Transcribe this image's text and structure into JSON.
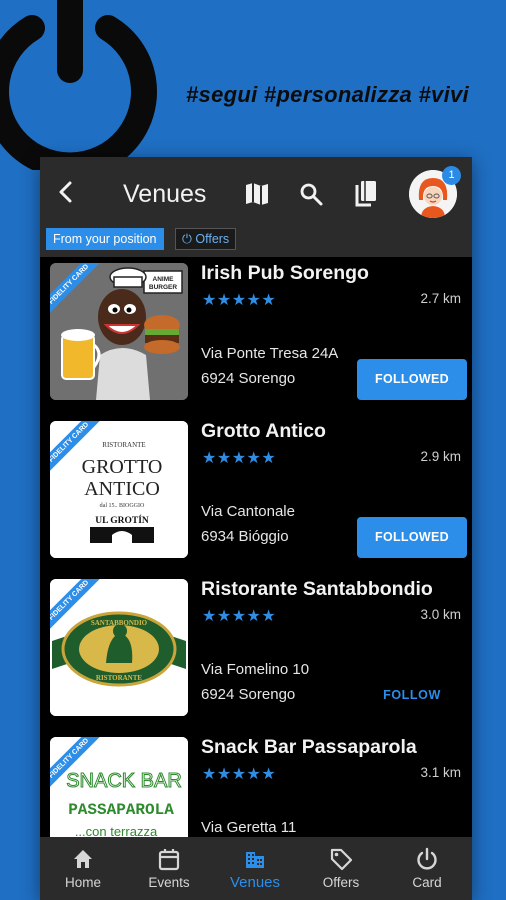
{
  "tagline": "#segui #personalizza #vivi",
  "header": {
    "title": "Venues",
    "notification_count": "1"
  },
  "filters": {
    "position": "From your position",
    "offers": "Offers"
  },
  "venues": [
    {
      "name": "Irish Pub Sorengo",
      "rating": "★★★★★",
      "distance": "2.7 km",
      "street": "Via Ponte Tresa 24A",
      "city": "6924 Sorengo",
      "action": "FOLLOWED",
      "ribbon": "FIDELITY CARD",
      "logo_text": "ANIME BURGER"
    },
    {
      "name": "Grotto Antico",
      "rating": "★★★★★",
      "distance": "2.9 km",
      "street": "Via Cantonale",
      "city": "6934 Bióggio",
      "action": "FOLLOWED",
      "ribbon": "FIDELITY CARD",
      "logo_top": "RISTORANTE",
      "logo_line1": "GROTTO",
      "logo_line2": "ANTICO",
      "logo_sub": "dal 15.. BIOGGIO",
      "logo_bottom": "UL GROTÍN"
    },
    {
      "name": "Ristorante Santabbondio",
      "rating": "★★★★★",
      "distance": "3.0 km",
      "street": "Via Fomelino 10",
      "city": "6924 Sorengo",
      "action": "FOLLOW",
      "ribbon": "FIDELITY CARD",
      "logo_top": "SANTABBONDIO",
      "logo_bottom": "RISTORANTE"
    },
    {
      "name": "Snack Bar Passaparola",
      "rating": "★★★★★",
      "distance": "3.1 km",
      "street": "Via Geretta 11",
      "city": "",
      "action": "",
      "ribbon": "FIDELITY CARD",
      "logo_line1": "SNACK BAR",
      "logo_line2": "PASSAPAROLA",
      "logo_sub": "...con terrazza"
    }
  ],
  "nav": [
    {
      "label": "Home",
      "icon": "home-icon"
    },
    {
      "label": "Events",
      "icon": "calendar-icon"
    },
    {
      "label": "Venues",
      "icon": "building-icon"
    },
    {
      "label": "Offers",
      "icon": "tag-icon"
    },
    {
      "label": "Card",
      "icon": "power-icon"
    }
  ],
  "colors": {
    "background": "#1f6fc4",
    "accent": "#2c8ee8",
    "bar": "#2b2b2b",
    "list_bg": "#000000"
  }
}
